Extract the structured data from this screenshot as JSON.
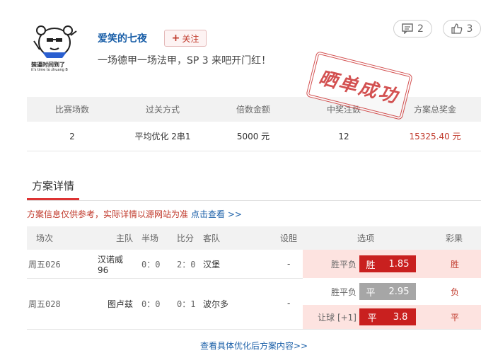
{
  "user": {
    "name": "爱笑的七夜",
    "follow_label": "关注",
    "motto": "一场德甲一场法甲，SP 3 来吧开门红！",
    "avatar_caption": "装逼时间到了",
    "avatar_caption_en": "it's time to zhuang B"
  },
  "counts": {
    "comments": "2",
    "likes": "3"
  },
  "stamp_text": "晒单成功",
  "summary": {
    "headers": [
      "比赛场数",
      "过关方式",
      "倍数金额",
      "中奖注数",
      "方案总奖金"
    ],
    "values": [
      "2",
      "平均优化 2串1",
      "5000 元",
      "12",
      "15325.40 元"
    ]
  },
  "tab_label": "方案详情",
  "notice": {
    "text": "方案信息仅供参考，实际详情以源网站为准",
    "link": "点击查看 >>"
  },
  "detail_headers": {
    "match_no": "场次",
    "home": "主队",
    "half": "半场",
    "score": "比分",
    "away": "客队",
    "handicap": "设胆",
    "options": "选项",
    "result": "彩果"
  },
  "matches": [
    {
      "match_no": "周五026",
      "home": "汉诺威96",
      "half": "0：0",
      "score": "2：0",
      "away": "汉堡",
      "handicap": "-",
      "options": [
        {
          "label": "胜平负",
          "pick": "胜",
          "odds": "1.85",
          "result": "胜"
        }
      ]
    },
    {
      "match_no": "周五028",
      "home": "图卢兹",
      "half": "0：0",
      "score": "0：1",
      "away": "波尔多",
      "handicap": "-",
      "options": [
        {
          "label": "胜平负",
          "pick": "平",
          "odds": "2.95",
          "result": "负"
        },
        {
          "label": "让球 [+1]",
          "pick": "平",
          "odds": "3.8",
          "result": "平"
        }
      ]
    }
  ],
  "footer_link": "查看具体优化后方案内容>>",
  "colors": {
    "accent_red": "#c9201f",
    "link_blue": "#1a5fa8",
    "highlight_bg": "#fde3e0"
  }
}
